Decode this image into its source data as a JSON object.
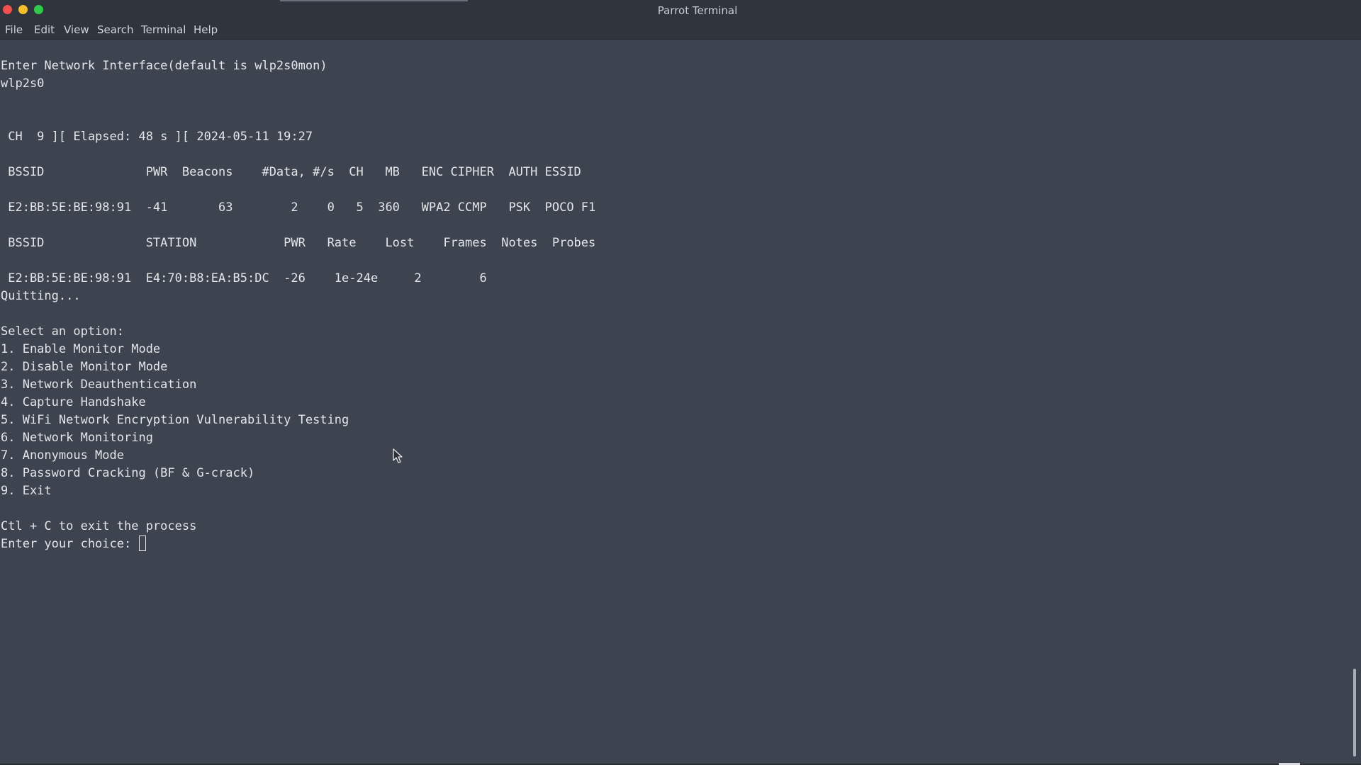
{
  "window": {
    "title": "Parrot Terminal",
    "controls": {
      "close_color": "#f24f4f",
      "minimize_color": "#f5be2a",
      "maximize_color": "#2fca4a"
    }
  },
  "menubar": {
    "items": [
      {
        "label": "File"
      },
      {
        "label": "Edit"
      },
      {
        "label": "View"
      },
      {
        "label": "Search"
      },
      {
        "label": "Terminal"
      },
      {
        "label": "Help"
      }
    ]
  },
  "terminal": {
    "lines": [
      "Enter Network Interface(default is wlp2s0mon)",
      "wlp2s0",
      "",
      "",
      " CH  9 ][ Elapsed: 48 s ][ 2024-05-11 19:27",
      "",
      " BSSID              PWR  Beacons    #Data, #/s  CH   MB   ENC CIPHER  AUTH ESSID",
      "",
      " E2:BB:5E:BE:98:91  -41       63        2    0   5  360   WPA2 CCMP   PSK  POCO F1",
      "",
      " BSSID              STATION            PWR   Rate    Lost    Frames  Notes  Probes",
      "",
      " E2:BB:5E:BE:98:91  E4:70:B8:EA:B5:DC  -26    1e-24e     2        6",
      "Quitting...",
      "",
      "Select an option:",
      "1. Enable Monitor Mode",
      "2. Disable Monitor Mode",
      "3. Network Deauthentication",
      "4. Capture Handshake",
      "5. WiFi Network Encryption Vulnerability Testing",
      "6. Network Monitoring",
      "7. Anonymous Mode",
      "8. Password Cracking (BF & G-crack)",
      "9. Exit",
      "",
      "Ctl + C to exit the process"
    ],
    "prompt": "Enter your choice: ",
    "colors": {
      "background": "#3d4450",
      "foreground": "#e3e5e8"
    }
  }
}
